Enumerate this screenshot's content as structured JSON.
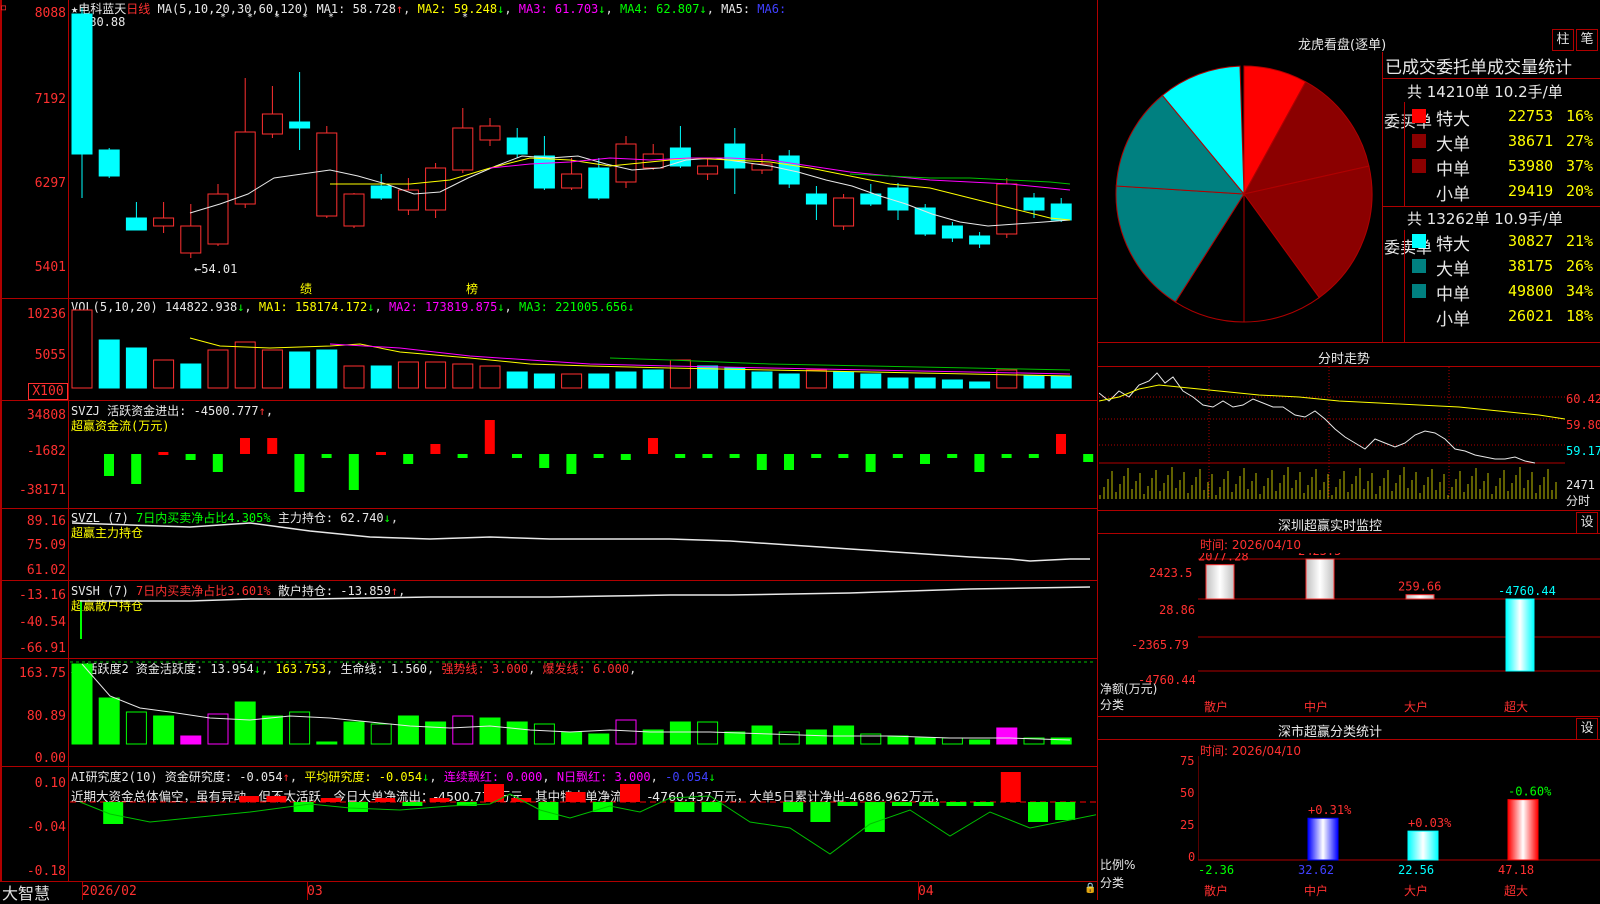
{
  "header": {
    "star": "★",
    "stock": "电科蓝天",
    "period": "日线",
    "ma_label": "MA(5,10,20,30,60,120)",
    "ma1": "MA1: 58.728",
    "ma2": "MA2: 59.248",
    "ma3": "MA3: 61.703",
    "ma4": "MA4: 62.807",
    "ma5": "MA5:",
    "ma6": "MA6:",
    "high_mark": "80.88",
    "low_mark": "54.01",
    "tag1": "绩",
    "tag2": "榜"
  },
  "price_axis": [
    "8088",
    "7192",
    "6297",
    "5401"
  ],
  "vol": {
    "label": "VOL(5,10,20)",
    "value": "144822.938",
    "ma1": "MA1: 158174.172",
    "ma2": "MA2: 173819.875",
    "ma3": "MA3: 221005.656",
    "axis": [
      "10236",
      "5055",
      "X100"
    ]
  },
  "svzj": {
    "label": "SVZJ  活跃资金进出: -4500.777",
    "sub": "超赢资金流(万元)",
    "axis": [
      "34808",
      "-1682",
      "-38171"
    ]
  },
  "svzl": {
    "label": "SVZL (7)",
    "pct": "7日内买卖净占比4.305%",
    "pos": "主力持仓: 62.740",
    "sub": "超赢主力持仓",
    "axis": [
      "89.16",
      "75.09",
      "61.02"
    ]
  },
  "svsh": {
    "label": "SVSH (7)",
    "pct": "7日内买卖净占比3.601%",
    "pos": "散户持仓: -13.859",
    "sub": "超赢散户持仓",
    "axis": [
      "-13.16",
      "-40.54",
      "-66.91"
    ]
  },
  "ai1": {
    "label": "AI活跃度2",
    "v1": "资金活跃度: 13.954",
    "v2": "163.753",
    "v3": "生命线: 1.560",
    "v4": "强势线: 3.000",
    "v5": "爆发线: 6.000",
    "axis": [
      "163.75",
      "80.89",
      "0.00"
    ]
  },
  "ai2": {
    "label": "AI研究度2(10)",
    "v1": "资金研究度: -0.054",
    "v2": "平均研究度: -0.054",
    "v3": "连续飘红: 0.000",
    "v4": "N日飘红: 3.000",
    "v5": "-0.054",
    "comment": "近期大资金总体偏空，虽有异动，但不太活跃，今日大单净流出：-4500.778万元，其中特大单净流出：-4760.437万元，大单5日累计净出-4686.962万元，",
    "axis": [
      "0.10",
      "-0.04",
      "-0.18"
    ]
  },
  "xaxis": {
    "feb": "2026/02",
    "mar": "03",
    "apr": "04"
  },
  "brand": "大智慧",
  "right": {
    "pie_title": "龙虎看盘(逐单)",
    "btn1": "柱",
    "btn2": "笔",
    "stats_title": "已成交委托单成交量统计",
    "buy_header": "共 14210单 10.2手/单",
    "sell_header": "共 13262单 10.9手/单",
    "buy_side": "委买单",
    "sell_side": "委卖单",
    "buy_rows": [
      {
        "name": "特大",
        "vol": "22753",
        "pct": "16%",
        "color": "#ff0000"
      },
      {
        "name": "大单",
        "vol": "38671",
        "pct": "27%",
        "color": "#8b0000"
      },
      {
        "name": "中单",
        "vol": "53980",
        "pct": "37%",
        "color": "#8b0000"
      },
      {
        "name": "小单",
        "vol": "29419",
        "pct": "20%",
        "color": "#000000"
      }
    ],
    "sell_rows": [
      {
        "name": "特大",
        "vol": "30827",
        "pct": "21%",
        "color": "#00ffff"
      },
      {
        "name": "大单",
        "vol": "38175",
        "pct": "26%",
        "color": "#008080"
      },
      {
        "name": "中单",
        "vol": "49800",
        "pct": "34%",
        "color": "#008080"
      },
      {
        "name": "小单",
        "vol": "26021",
        "pct": "18%",
        "color": "#000000"
      }
    ],
    "intraday_title": "分时走势",
    "intraday_axis": [
      "60.42",
      "59.80",
      "59.17"
    ],
    "intraday_vol": "2471",
    "intraday_vol2": "分时",
    "sz_title": "深圳超赢实时监控",
    "sz_btn": "设",
    "sz_time": "时间: 2026/04/10",
    "sz_axis": [
      "2423.5",
      "28.86",
      "-2365.79",
      "-4760.44"
    ],
    "sz_unit": "净额(万元)",
    "sz_cat": "分类",
    "sz_values": [
      "2077.28",
      "2423.5",
      "259.66",
      "-4760.44"
    ],
    "sz_cats": [
      "散户",
      "中户",
      "大户",
      "超大"
    ],
    "cls_title": "深市超赢分类统计",
    "cls_btn": "设",
    "cls_time": "时间: 2026/04/10",
    "cls_axis": [
      "75",
      "50",
      "25",
      "0"
    ],
    "cls_unit": "比例%",
    "cls_cat": "分类",
    "cls_changes": [
      "+0.31%",
      "+0.03%",
      "-0.60%"
    ],
    "cls_values": [
      "-2.36",
      "32.62",
      "22.56",
      "47.18"
    ],
    "cls_cats": [
      "散户",
      "中户",
      "大户",
      "超大"
    ]
  }
}
